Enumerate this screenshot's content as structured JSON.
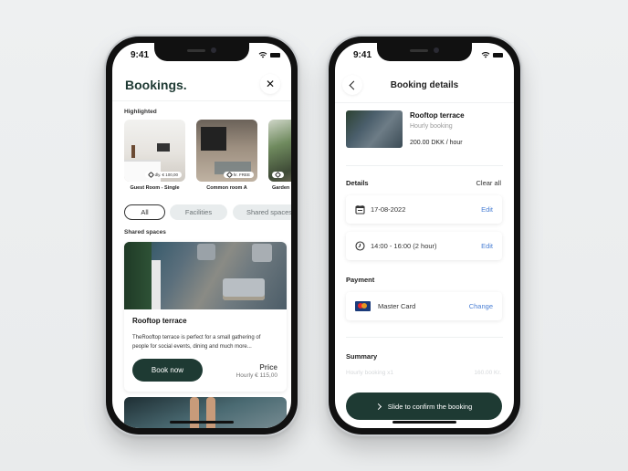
{
  "status_bar": {
    "time": "9:41"
  },
  "bookings_screen": {
    "title": "Bookings.",
    "close_icon": "close-icon",
    "highlighted_label": "Highlighted",
    "highlighted": [
      {
        "name": "Guest Room - Single",
        "price": "dly. € 100,00"
      },
      {
        "name": "Common room A",
        "price": "hr. FREE"
      },
      {
        "name": "Garden",
        "price": ""
      }
    ],
    "filters": [
      {
        "label": "All",
        "active": true
      },
      {
        "label": "Facilities",
        "active": false
      },
      {
        "label": "Shared spaces",
        "active": false
      }
    ],
    "shared_spaces_label": "Shared spaces",
    "space_card": {
      "title": "Rooftop terrace",
      "description": "TheRooftop terrace is perfect for a small gathering of people for social events, dining and much more...",
      "book_label": "Book now",
      "price_label": "Price",
      "price_value": "Hourly € 115,00"
    }
  },
  "details_screen": {
    "title": "Booking details",
    "venue": {
      "name": "Rooftop terrace",
      "type": "Hourly booking",
      "price": "200.00 DKK / hour"
    },
    "details_label": "Details",
    "clear_all": "Clear all",
    "date": {
      "value": "17-08-2022",
      "action": "Edit"
    },
    "time": {
      "value": "14:00 - 16:00 (2 hour)",
      "action": "Edit"
    },
    "payment_label": "Payment",
    "payment": {
      "method": "Master Card",
      "action": "Change"
    },
    "summary_label": "Summary",
    "summary_line": {
      "item": "Hourly booking x1",
      "amount": "160.00 Kr."
    },
    "slide_label": "Slide to confirm the booking"
  },
  "colors": {
    "brand": "#1e3a33",
    "link": "#4a7fd4"
  }
}
